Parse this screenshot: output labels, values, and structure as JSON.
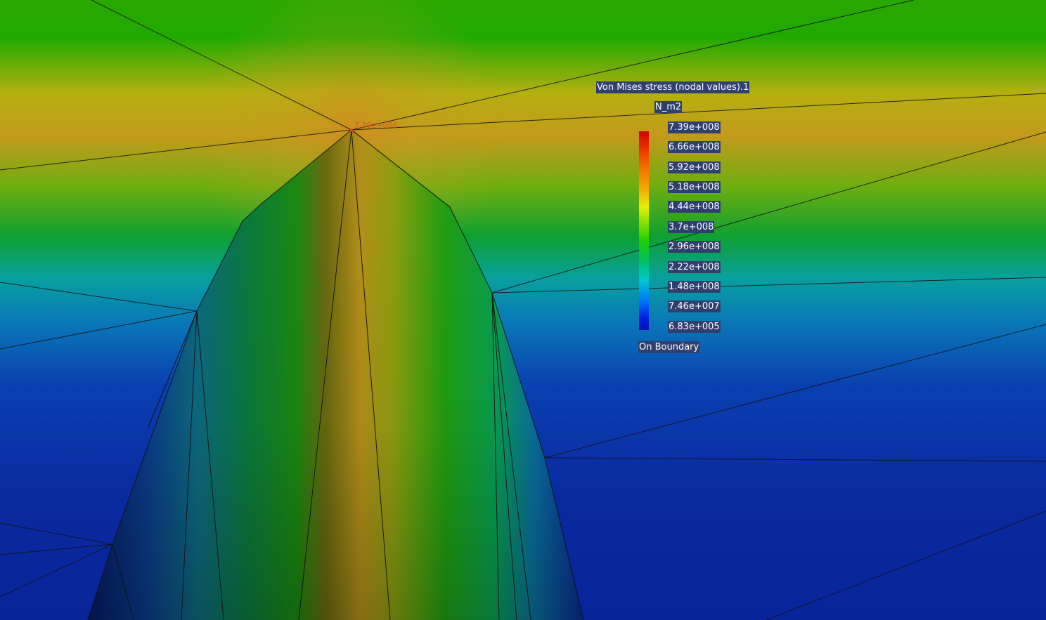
{
  "legend": {
    "title": "Von Mises stress (nodal values).1",
    "units": "N_m2",
    "ticks": [
      "7.39e+008",
      "6.66e+008",
      "5.92e+008",
      "5.18e+008",
      "4.44e+008",
      "3.7e+008",
      "2.96e+008",
      "2.22e+008",
      "1.48e+008",
      "7.46e+007",
      "6.83e+005"
    ],
    "footer": "On Boundary"
  },
  "probe": {
    "value": "7.39e+008"
  },
  "colors": {
    "max": "#d30000",
    "min": "#0010b0",
    "label_bg": "#2f3f6e"
  }
}
